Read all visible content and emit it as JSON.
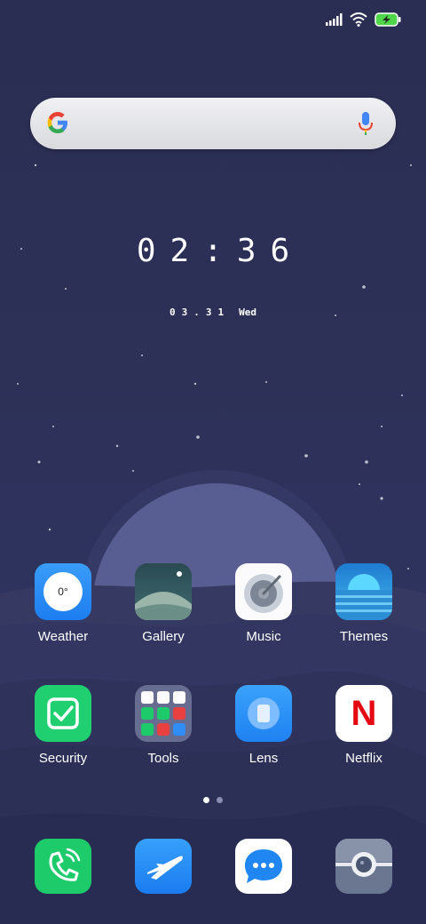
{
  "status_bar": {
    "icons": [
      "signal-icon",
      "wifi-icon",
      "battery-charging-icon"
    ]
  },
  "search": {
    "logo": "google-g-icon",
    "mic": "mic-icon"
  },
  "clock": {
    "time": "02:36",
    "date": "03.31",
    "weekday": "Wed"
  },
  "home_apps": [
    {
      "label": "Weather",
      "icon": "weather-icon",
      "value": "0°"
    },
    {
      "label": "Gallery",
      "icon": "gallery-icon"
    },
    {
      "label": "Music",
      "icon": "music-icon"
    },
    {
      "label": "Themes",
      "icon": "themes-icon"
    },
    {
      "label": "Security",
      "icon": "security-icon"
    },
    {
      "label": "Tools",
      "icon": "tools-folder-icon"
    },
    {
      "label": "Lens",
      "icon": "lens-icon"
    },
    {
      "label": "Netflix",
      "icon": "netflix-icon",
      "letter": "N"
    }
  ],
  "page_indicator": {
    "pages": 2,
    "current": 1
  },
  "dock": [
    {
      "icon": "phone-icon"
    },
    {
      "icon": "browser-icon"
    },
    {
      "icon": "messages-icon"
    },
    {
      "icon": "camera-icon"
    }
  ],
  "colors": {
    "background": "#2c3058",
    "moon": "#5c6194",
    "accent_blue": "#2f8df5",
    "accent_green": "#1ecb6b",
    "netflix_red": "#e50914"
  }
}
